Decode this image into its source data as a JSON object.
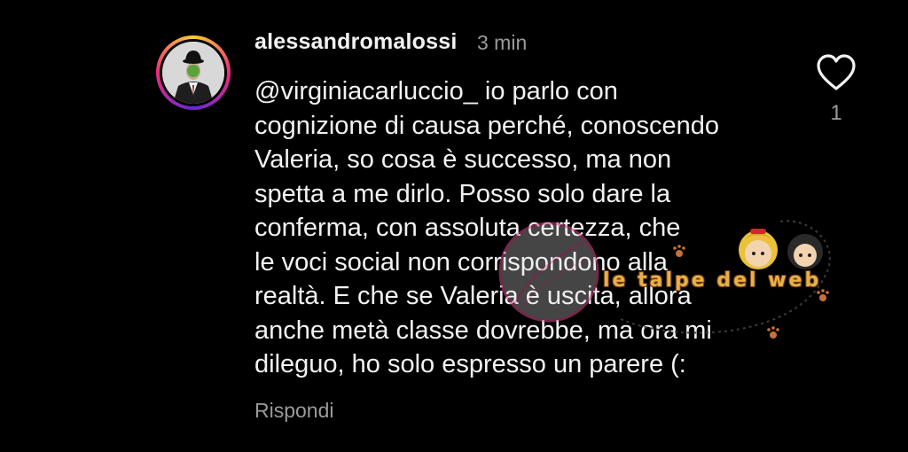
{
  "comment": {
    "username": "alessandromalossi",
    "timestamp": "3 min",
    "lines": [
      "@virginiacarluccio_  io parlo con",
      "cognizione di causa perché, conoscendo",
      "Valeria, so cosa è successo, ma non",
      "spetta a me dirlo. Posso solo dare la",
      "conferma, con assoluta certezza, che",
      "le voci social non corrispondono alla",
      "realtà. E che se Valeria è uscita, allora",
      "anche metà classe dovrebbe, ma ora mi",
      "dileguo, ho solo espresso un parere (:"
    ],
    "reply_label": "Rispondi",
    "like_count": "1",
    "icons": {
      "like": "heart-outline-icon",
      "avatar": "profile-avatar"
    }
  },
  "watermark": {
    "brand_text": "le talpe del web"
  },
  "colors": {
    "background": "#000000",
    "text": "#f2f2f2",
    "secondary": "#9a9a9a",
    "story_ring": "#ee2a7b"
  }
}
